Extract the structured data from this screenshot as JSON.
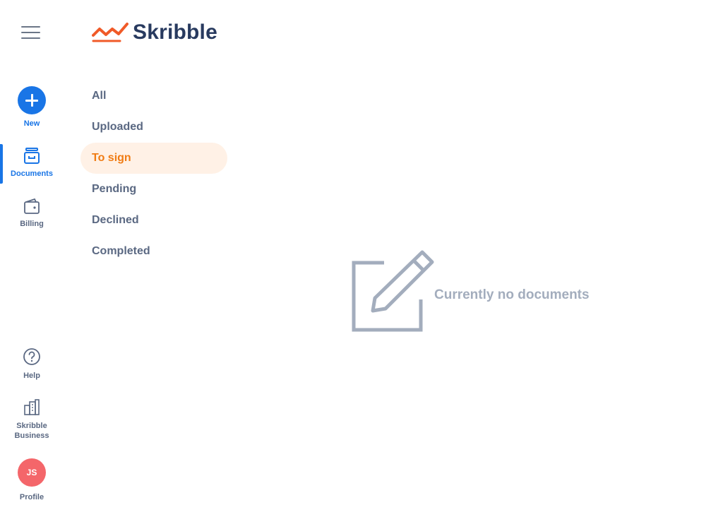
{
  "app": {
    "name": "Skribble"
  },
  "nav": {
    "new_label": "New",
    "items": [
      {
        "id": "documents",
        "label": "Documents",
        "icon": "document-box-icon",
        "active": true
      },
      {
        "id": "billing",
        "label": "Billing",
        "icon": "wallet-icon",
        "active": false
      }
    ],
    "bottom_items": [
      {
        "id": "help",
        "label": "Help",
        "icon": "help-circle-icon"
      },
      {
        "id": "business",
        "label_line1": "Skribble",
        "label_line2": "Business",
        "icon": "buildings-icon"
      },
      {
        "id": "profile",
        "label": "Profile",
        "initials": "JS"
      }
    ]
  },
  "filters": [
    {
      "label": "All",
      "active": false
    },
    {
      "label": "Uploaded",
      "active": false
    },
    {
      "label": "To sign",
      "active": true
    },
    {
      "label": "Pending",
      "active": false
    },
    {
      "label": "Declined",
      "active": false
    },
    {
      "label": "Completed",
      "active": false
    }
  ],
  "empty_state": {
    "message": "Currently no documents",
    "icon": "edit-pencil-icon"
  },
  "colors": {
    "brand_blue": "#1975e6",
    "logo_text": "#283a5f",
    "logo_mark": "#f05a28",
    "active_filter_bg": "#fff1e6",
    "active_filter_text": "#f07c14",
    "avatar_bg": "#f4666a",
    "muted": "#a3adbd"
  }
}
